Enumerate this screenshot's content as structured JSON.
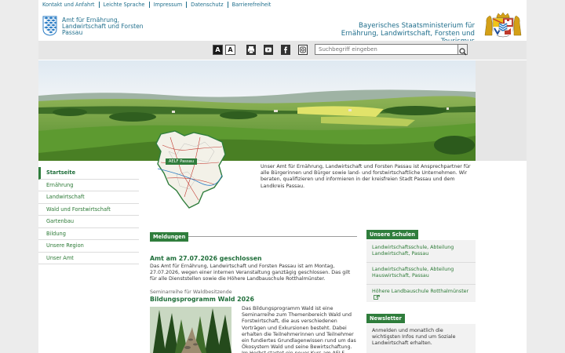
{
  "top_links": [
    "Kontakt und Anfahrt",
    "Leichte Sprache",
    "Impressum",
    "Datenschutz",
    "Barrierefreiheit"
  ],
  "header": {
    "amt_title": "Amt für Ernährung, Landwirtschaft und Forsten Passau",
    "ministry_line1": "Bayerisches Staatsministerium für",
    "ministry_line2": "Ernährung, Landwirtschaft, Forsten und Tourismus"
  },
  "toolbar": {
    "contrast_dark": "A",
    "contrast_light": "A",
    "search_placeholder": "Suchbegriff eingeben"
  },
  "map_label": "AELF Passau",
  "nav": [
    {
      "label": "Startseite",
      "active": true
    },
    {
      "label": "Ernährung",
      "active": false
    },
    {
      "label": "Landwirtschaft",
      "active": false
    },
    {
      "label": "Wald und Forstwirtschaft",
      "active": false
    },
    {
      "label": "Gartenbau",
      "active": false
    },
    {
      "label": "Bildung",
      "active": false
    },
    {
      "label": "Unsere Region",
      "active": false
    },
    {
      "label": "Unser Amt",
      "active": false
    }
  ],
  "intro": "Unser Amt für Ernährung, Landwirtschaft und Forsten Passau ist Ansprechpartner für alle Bürgerinnen und Bürger sowie land- und forstwirtschaftliche Unternehmen. Wir beraten, qualifizieren und informieren in der kreisfreien Stadt Passau und dem Landkreis Passau.",
  "meldungen": {
    "heading": "Meldungen",
    "news1_title": "Amt am 27.07.2026 geschlossen",
    "news1_text": "Das Amt für Ernährung, Landwirtschaft und Forsten Passau ist am Montag, 27.07.2026, wegen einer internen Veranstaltung ganztägig geschlossen. Das gilt für alle Dienststellen sowie die Höhere Landbauschule Rotthalmünster.",
    "news2_kicker": "Seminarreihe für Waldbesitzende",
    "news2_title": "Bildungsprogramm Wald 2026",
    "news2_text": "Das Bildungsprogramm Wald ist eine Seminarreihe zum Themenbereich Wald und Forstwirtschaft, die aus verschiedenen Vorträgen und Exkursionen besteht. Dabei erhalten die Teilnehmerinnen und Teilnehmer ein fundiertes Grundlagenwissen rund um das Ökosystem Wald und seine Bewirtschaftung. Im Herbst startet ein neuer Kurs am AELF Passau."
  },
  "schulen": {
    "heading": "Unsere Schulen",
    "items": [
      "Landwirtschaftsschule, Abteilung Landwirtschaft, Passau",
      "Landwirtschaftsschule, Abteilung Hauswirtschaft, Passau",
      "Höhere Landbauschule Rotthalmünster"
    ]
  },
  "newsletter": {
    "heading": "Newsletter",
    "text": "Anmelden und monatlich die wichtigsten Infos rund um Soziale Landwirtschaft erhalten."
  },
  "colors": {
    "brand_green": "#2f7d3c",
    "link_blue": "#1f6e8c",
    "bavaria_blue": "#2b7cc4"
  }
}
